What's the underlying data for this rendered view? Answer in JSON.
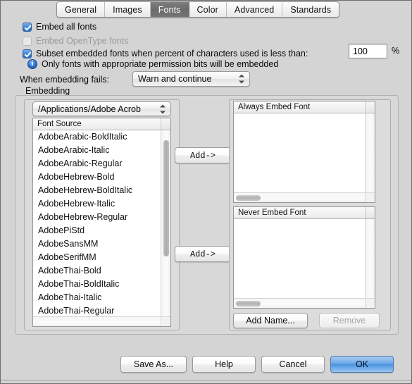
{
  "window": {
    "tabs": [
      {
        "label": "General",
        "selected": false
      },
      {
        "label": "Images",
        "selected": false
      },
      {
        "label": "Fonts",
        "selected": true
      },
      {
        "label": "Color",
        "selected": false
      },
      {
        "label": "Advanced",
        "selected": false
      },
      {
        "label": "Standards",
        "selected": false
      }
    ]
  },
  "options": {
    "embed_all_fonts": {
      "label": "Embed all fonts",
      "checked": true,
      "enabled": true
    },
    "embed_opentype": {
      "label": "Embed OpenType fonts",
      "checked": false,
      "enabled": false
    },
    "subset": {
      "label": "Subset embedded fonts when percent of characters used is less than:",
      "checked": true,
      "enabled": true,
      "value": "100",
      "unit": "%"
    },
    "permission_note": {
      "icon": "info-icon",
      "text": "Only fonts with appropriate permission bits will be embedded"
    },
    "embedding_fails": {
      "label": "When embedding fails:",
      "value": "Warn and continue"
    }
  },
  "embedding": {
    "title": "Embedding",
    "source_popup": {
      "value": "/Applications/Adobe Acrob"
    },
    "font_source": {
      "header": "Font Source",
      "items": [
        "AdobeArabic-BoldItalic",
        "AdobeArabic-Italic",
        "AdobeArabic-Regular",
        "AdobeHebrew-Bold",
        "AdobeHebrew-BoldItalic",
        "AdobeHebrew-Italic",
        "AdobeHebrew-Regular",
        "AdobePiStd",
        "AdobeSansMM",
        "AdobeSerifMM",
        "AdobeThai-Bold",
        "AdobeThai-BoldItalic",
        "AdobeThai-Italic",
        "AdobeThai-Regular"
      ]
    },
    "add_always_label": "Add->",
    "add_never_label": "Add->",
    "always_embed": {
      "header": "Always Embed Font",
      "items": []
    },
    "never_embed": {
      "header": "Never Embed Font",
      "items": []
    },
    "add_name_label": "Add Name...",
    "remove_label": "Remove",
    "remove_enabled": false
  },
  "footer": {
    "save_as": "Save As...",
    "help": "Help",
    "cancel": "Cancel",
    "ok": "OK"
  },
  "colors": {
    "window_bg": "#d4d4d4",
    "selected_tab_bg": "#6f6f6f",
    "accent_blue": "#3b7fd4",
    "default_button_blue": "#4b93e0"
  }
}
